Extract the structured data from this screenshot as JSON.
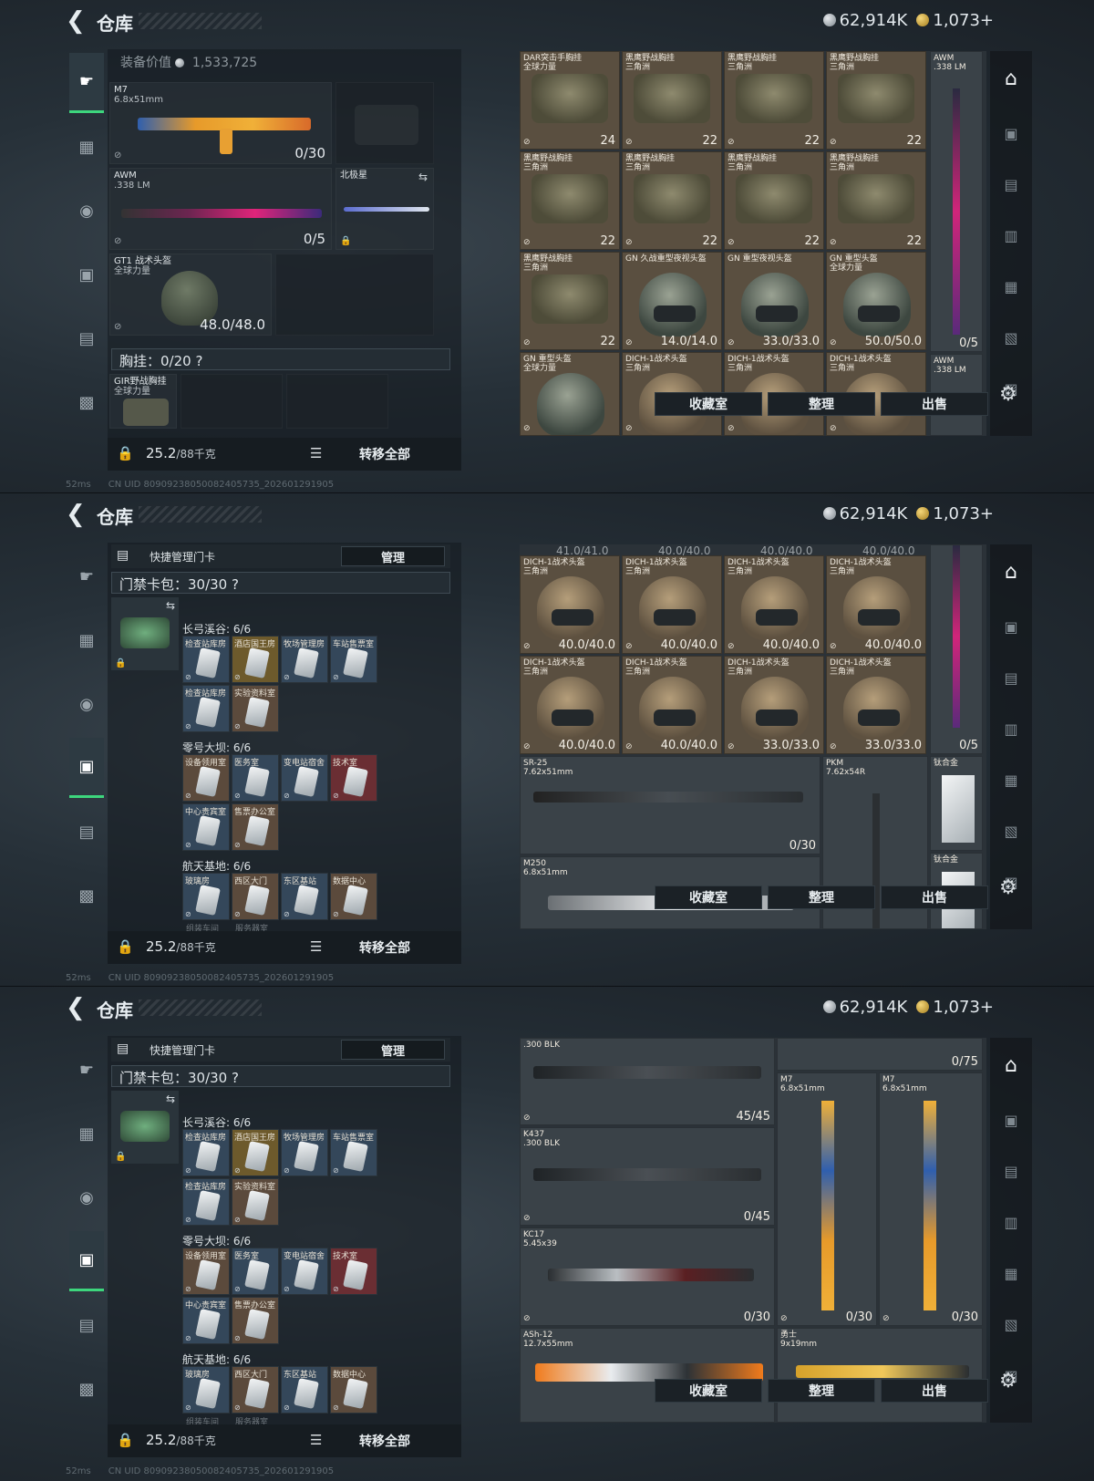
{
  "header": {
    "title": "仓库",
    "currency_silver": "62,914K",
    "currency_gold": "1,073+"
  },
  "footer": {
    "ping": "52ms",
    "uid": "CN UID 8090923805008240573​5_202601291905"
  },
  "bottom": {
    "weight_value": "25.2",
    "weight_cap": "/88千克",
    "transfer_label": "转移全部"
  },
  "actions": {
    "collection": "收藏室",
    "sort": "整理",
    "sell": "出售"
  },
  "screen1": {
    "equip_value_label": "装备价值",
    "equip_value": "1,533,725",
    "primary": {
      "name": "M7",
      "caliber": "6.8x51mm",
      "ammo": "0/30"
    },
    "secondary": {
      "name": "AWM",
      "caliber": ".338 LM",
      "ammo": "0/5"
    },
    "melee": {
      "name": "北极星"
    },
    "helmet": {
      "name": "GT1 战术头盔",
      "sub": "全球力量",
      "durability": "48.0/48.0"
    },
    "chest": {
      "label": "胸挂：0/20",
      "help": "?"
    },
    "rig": {
      "name": "GIR野战胸挂",
      "sub": "全球力量"
    },
    "grid": [
      {
        "name": "DAR突击手胸挂",
        "sub": "全球力量",
        "count": "24",
        "type": "bag"
      },
      {
        "name": "黑鹰野战胸挂",
        "sub": "三角洲",
        "count": "22",
        "type": "bag"
      },
      {
        "name": "黑鹰野战胸挂",
        "sub": "三角洲",
        "count": "22",
        "type": "bag"
      },
      {
        "name": "黑鹰野战胸挂",
        "sub": "三角洲",
        "count": "22",
        "type": "bag"
      },
      {
        "name": "黑鹰野战胸挂",
        "sub": "三角洲",
        "count": "22",
        "type": "bag"
      },
      {
        "name": "黑鹰野战胸挂",
        "sub": "三角洲",
        "count": "22",
        "type": "bag"
      },
      {
        "name": "黑鹰野战胸挂",
        "sub": "三角洲",
        "count": "22",
        "type": "bag"
      },
      {
        "name": "黑鹰野战胸挂",
        "sub": "三角洲",
        "count": "22",
        "type": "bag"
      },
      {
        "name": "黑鹰野战胸挂",
        "sub": "三角洲",
        "count": "22",
        "type": "bag"
      },
      {
        "name": "GN 久战重型夜视头盔",
        "sub": "",
        "count": "14.0/14.0",
        "type": "helm"
      },
      {
        "name": "GN 重型夜视头盔",
        "sub": "",
        "count": "33.0/33.0",
        "type": "helm"
      },
      {
        "name": "GN 重型头盔",
        "sub": "全球力量",
        "count": "50.0/50.0",
        "type": "helm"
      },
      {
        "name": "GN 重型头盔",
        "sub": "全球力量",
        "count": "",
        "type": "helm"
      },
      {
        "name": "DICH-1战术头盔",
        "sub": "三角洲",
        "count": "",
        "type": "helm"
      },
      {
        "name": "DICH-1战术头盔",
        "sub": "三角洲",
        "count": "",
        "type": "helm"
      },
      {
        "name": "DICH-1战术头盔",
        "sub": "三角洲",
        "count": "",
        "type": "helm"
      }
    ],
    "side_weapon": {
      "name": "AWM",
      "caliber": ".338 LM",
      "ammo": "0/5"
    },
    "side_weapon2": {
      "name": "AWM",
      "caliber": ".338 LM"
    }
  },
  "keys": {
    "header": "快捷管理门卡",
    "manage": "管理",
    "bag_label": "门禁卡包：30/30",
    "help": "?",
    "groups": [
      {
        "title": "长弓溪谷: 6/6",
        "cards": [
          "检查站库房",
          "酒店国王房",
          "牧场管理房",
          "车站售票室",
          "检查站库房",
          "实验资料室"
        ]
      },
      {
        "title": "零号大坝: 6/6",
        "cards": [
          "设备领用室",
          "医务室",
          "变电站宿舍",
          "技术室",
          "中心贵宾室",
          "售票办公室"
        ]
      },
      {
        "title": "航天基地: 6/6",
        "cards": [
          "玻璃房",
          "西区大门",
          "东区基站",
          "数据中心"
        ]
      }
    ],
    "more": [
      "组装车间",
      "服务器室"
    ]
  },
  "screen2": {
    "top_counts": [
      "41.0/41.0",
      "40.0/40.0",
      "40.0/40.0",
      "40.0/40.0"
    ],
    "helmets": [
      {
        "name": "DICH-1战术头盔",
        "sub": "三角洲",
        "dur": "40.0/40.0"
      },
      {
        "name": "DICH-1战术头盔",
        "sub": "三角洲",
        "dur": "40.0/40.0"
      },
      {
        "name": "DICH-1战术头盔",
        "sub": "三角洲",
        "dur": "40.0/40.0"
      },
      {
        "name": "DICH-1战术头盔",
        "sub": "三角洲",
        "dur": "40.0/40.0"
      },
      {
        "name": "DICH-1战术头盔",
        "sub": "三角洲",
        "dur": "40.0/40.0"
      },
      {
        "name": "DICH-1战术头盔",
        "sub": "三角洲",
        "dur": "40.0/40.0"
      },
      {
        "name": "DICH-1战术头盔",
        "sub": "三角洲",
        "dur": "33.0/33.0"
      },
      {
        "name": "DICH-1战术头盔",
        "sub": "三角洲",
        "dur": "33.0/33.0"
      }
    ],
    "side_ammo": "0/5",
    "sr25": {
      "name": "SR-25",
      "caliber": "7.62x51mm",
      "ammo": "0/30"
    },
    "pkm": {
      "name": "PKM",
      "caliber": "7.62x54R"
    },
    "m250": {
      "name": "M250",
      "caliber": "6.8x51mm"
    },
    "plate1": "钛合金",
    "plate2": "钛合金"
  },
  "screen3": {
    "w1": {
      "name": ".300 BLK",
      "ammo": "45/45"
    },
    "w2": {
      "name": "K437",
      "caliber": ".300 BLK",
      "ammo": "0/45"
    },
    "w3": {
      "name": "KC17",
      "caliber": "5.45x39",
      "ammo": "0/30"
    },
    "w4": {
      "name": "ASh-12",
      "caliber": "12.7x55mm"
    },
    "m7a": {
      "name": "M7",
      "caliber": "6.8x51mm",
      "ammo": "0/30"
    },
    "m7b": {
      "name": "M7",
      "caliber": "6.8x51mm",
      "ammo": "0/30"
    },
    "warrior": {
      "name": "勇士",
      "caliber": "9x19mm"
    },
    "top_ammo": "0/75"
  }
}
